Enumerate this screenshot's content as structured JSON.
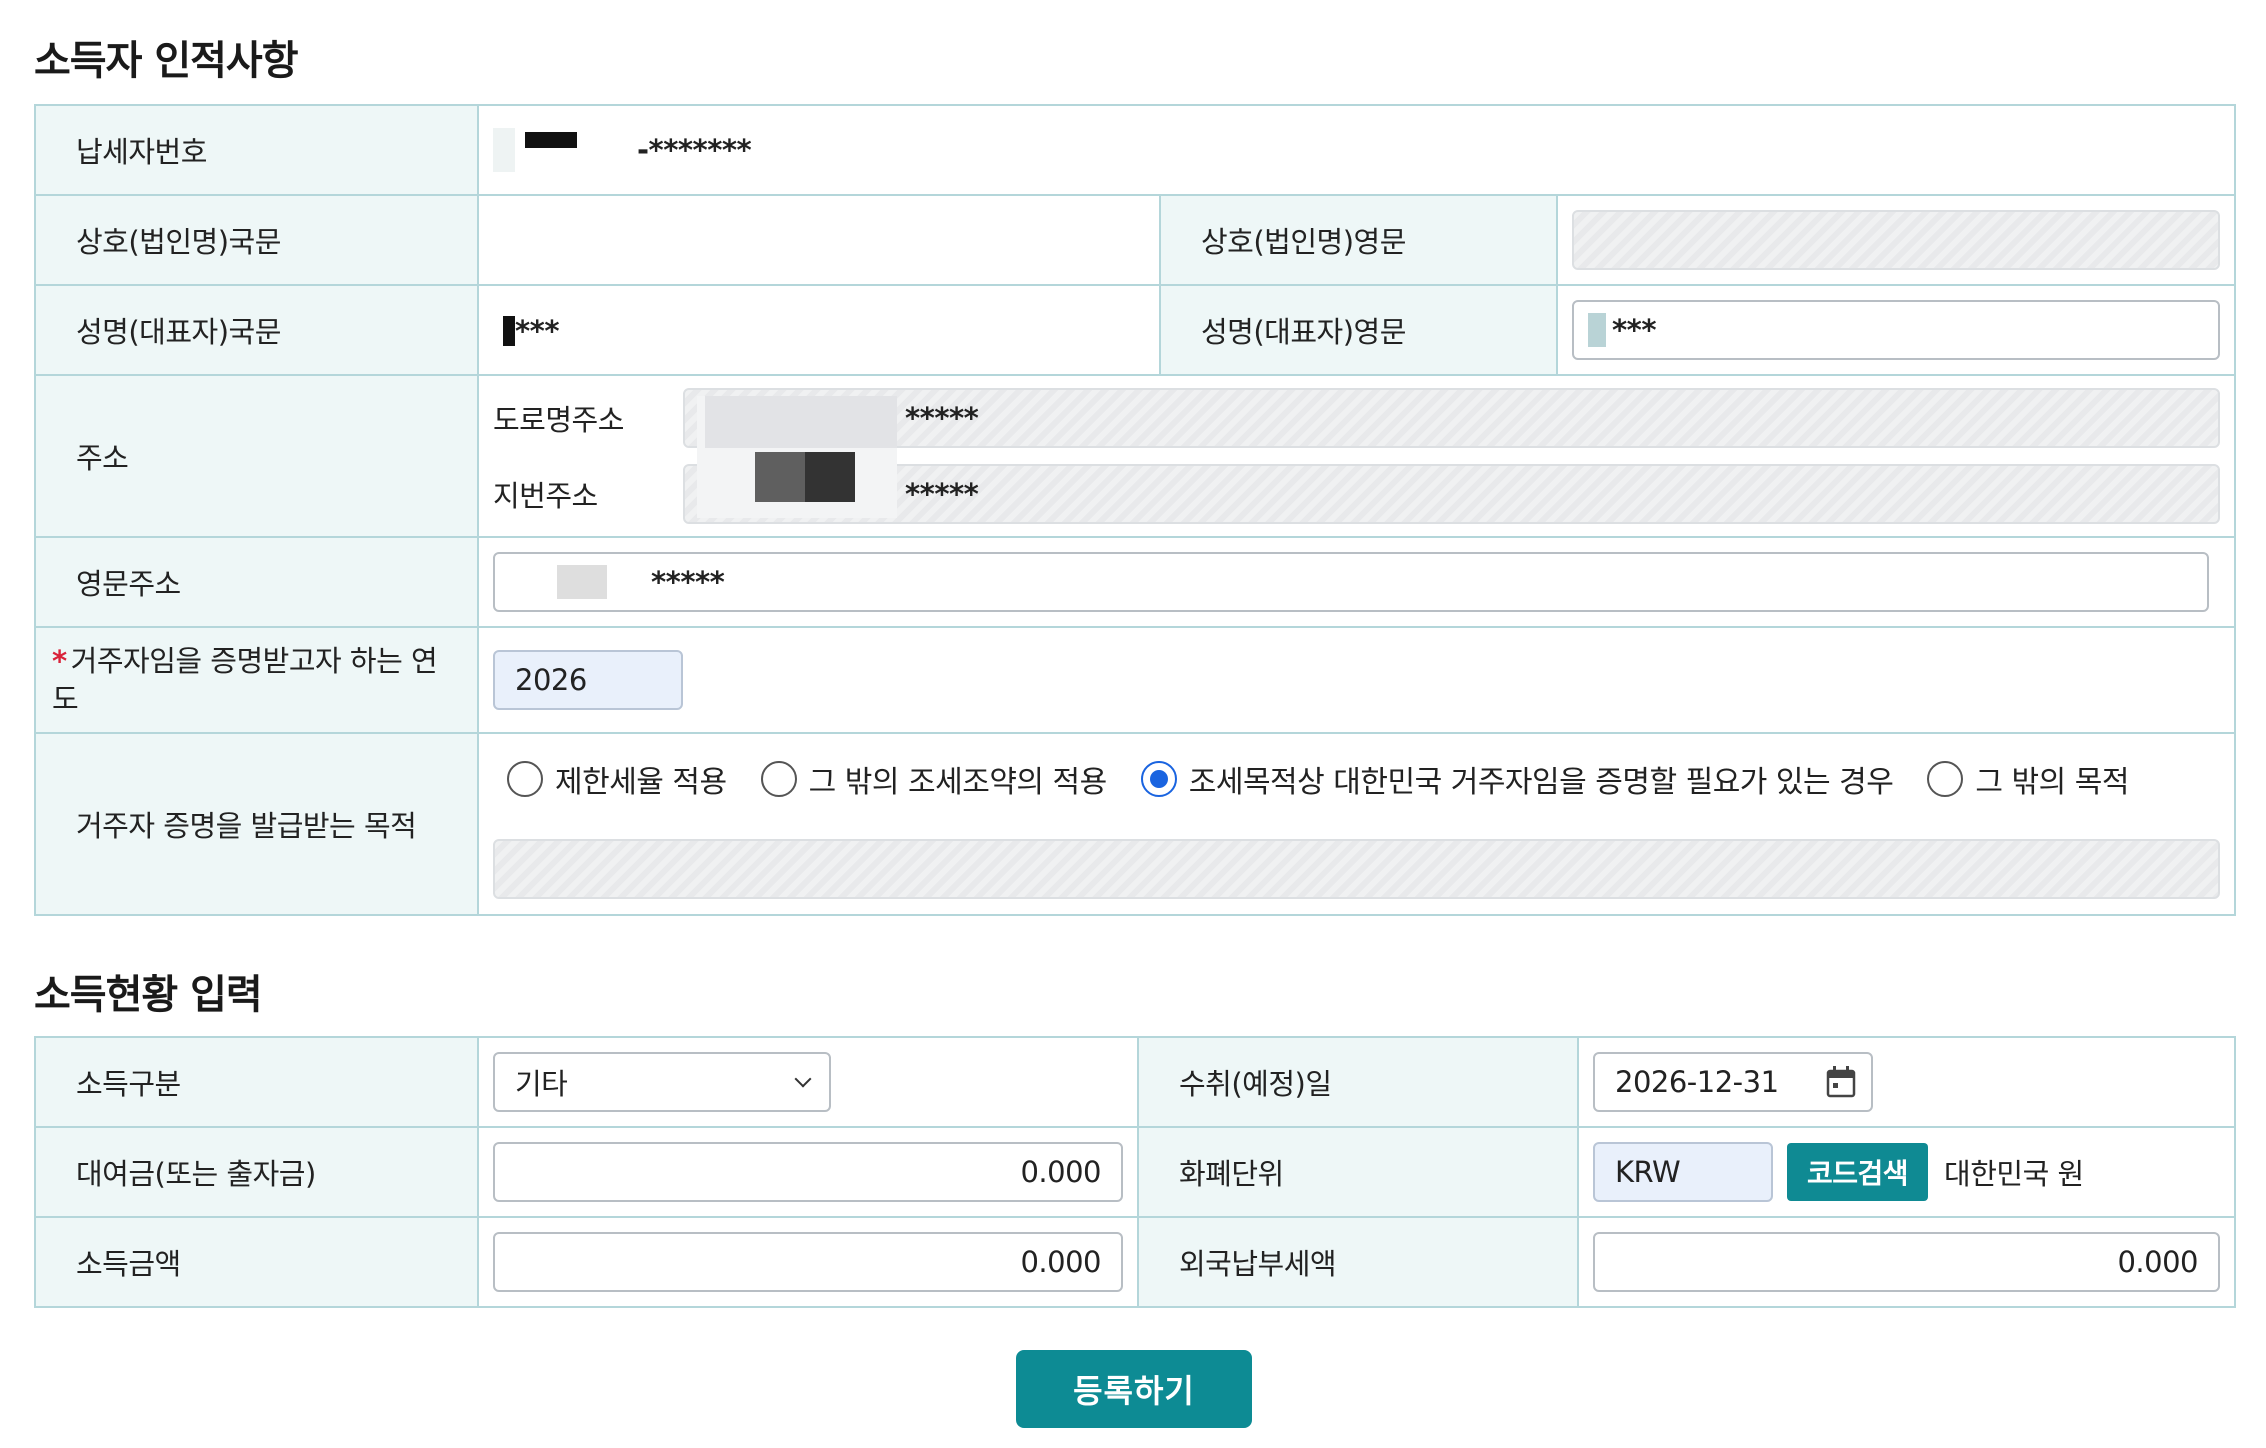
{
  "sections": {
    "personal_title": "소득자 인적사항",
    "income_title": "소득현황 입력"
  },
  "personal": {
    "tin_label": "납세자번호",
    "tin_value": "-*******",
    "name_kr_label": "상호(법인명)국문",
    "name_kr_value": "",
    "name_en_label": "상호(법인명)영문",
    "name_en_value": "",
    "rep_kr_label": "성명(대표자)국문",
    "rep_kr_value": "***",
    "rep_en_label": "성명(대표자)영문",
    "rep_en_value": "***",
    "address_label": "주소",
    "road_address_label": "도로명주소",
    "road_address_value": "*****",
    "lot_address_label": "지번주소",
    "lot_address_value": "*****",
    "eng_address_label": "영문주소",
    "eng_address_value": "*****",
    "year_label": "거주자임을 증명받고자 하는 연도",
    "year_required_mark": "*",
    "year_value": "2026",
    "purpose_label": "거주자 증명을 발급받는 목적",
    "purpose_options": [
      {
        "label": "제한세율 적용",
        "selected": false
      },
      {
        "label": "그 밖의 조세조약의 적용",
        "selected": false
      },
      {
        "label": "조세목적상 대한민국 거주자임을 증명할 필요가 있는 경우",
        "selected": true
      },
      {
        "label": "그 밖의 목적",
        "selected": false
      }
    ],
    "purpose_other_value": ""
  },
  "income": {
    "category_label": "소득구분",
    "category_value": "기타",
    "date_label": "수취(예정)일",
    "date_value": "2026-12-31",
    "loan_label": "대여금(또는 출자금)",
    "loan_value": "0.000",
    "currency_label": "화폐단위",
    "currency_value": "KRW",
    "code_search_label": "코드검색",
    "currency_name": "대한민국 원",
    "income_amount_label": "소득금액",
    "income_amount_value": "0.000",
    "foreign_tax_label": "외국납부세액",
    "foreign_tax_value": "0.000"
  },
  "submit_label": "등록하기",
  "colors": {
    "teal_accent": "#0d8b94",
    "label_bg": "#eef7f7",
    "border": "#b4d6da",
    "radio_selected": "#1a64e0",
    "required": "#d9233a"
  },
  "icons": [
    "chevron-down-icon",
    "calendar-icon"
  ]
}
